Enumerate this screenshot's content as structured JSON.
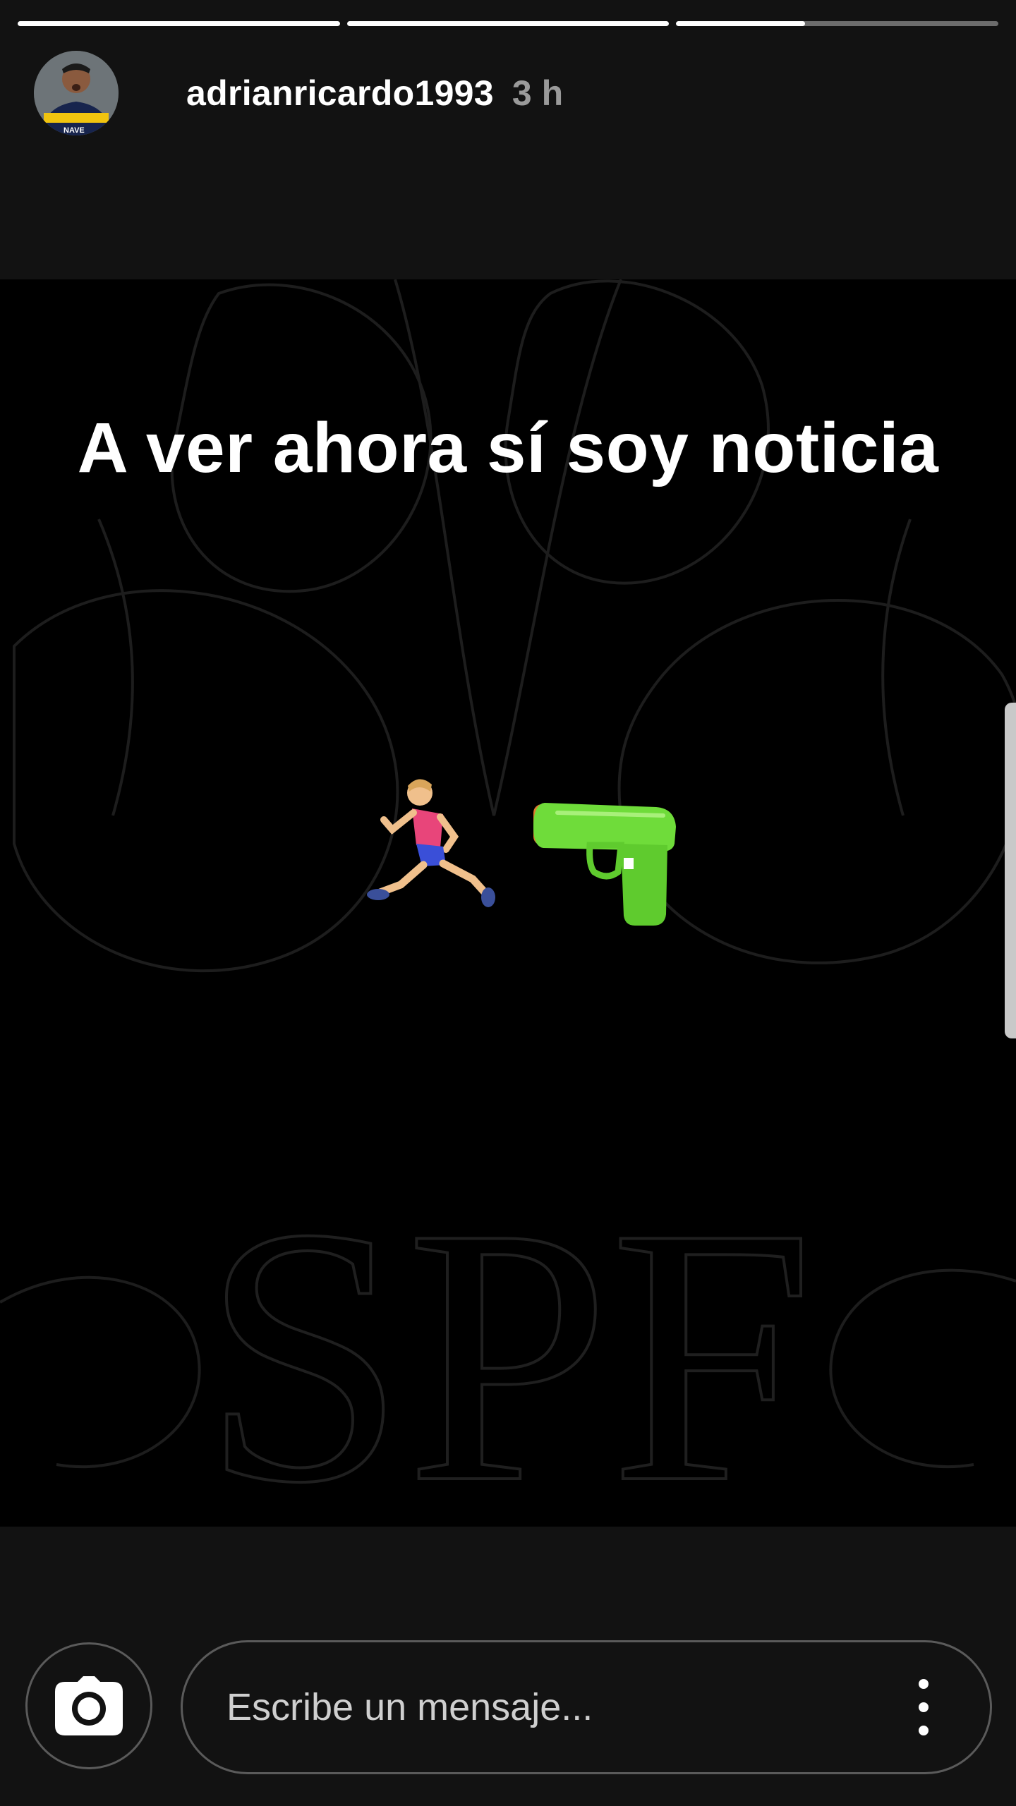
{
  "progress": {
    "segments": [
      {
        "fill": 1.0
      },
      {
        "fill": 1.0
      },
      {
        "fill": 0.4
      }
    ]
  },
  "header": {
    "username": "adrianricardo1993",
    "time": "3 h"
  },
  "story": {
    "caption": "A ver ahora sí soy noticia",
    "watermark_text": "SPF",
    "emojis": [
      "runner-emoji",
      "water-gun-emoji"
    ]
  },
  "composer": {
    "placeholder": "Escribe un mensaje...",
    "camera_icon": "camera-icon",
    "more_icon": "more-vertical-icon"
  },
  "colors": {
    "background": "#121212",
    "story_background": "#000000",
    "text": "#ffffff",
    "muted_text": "#9a9a9a",
    "water_gun": "#6fdc3a"
  }
}
